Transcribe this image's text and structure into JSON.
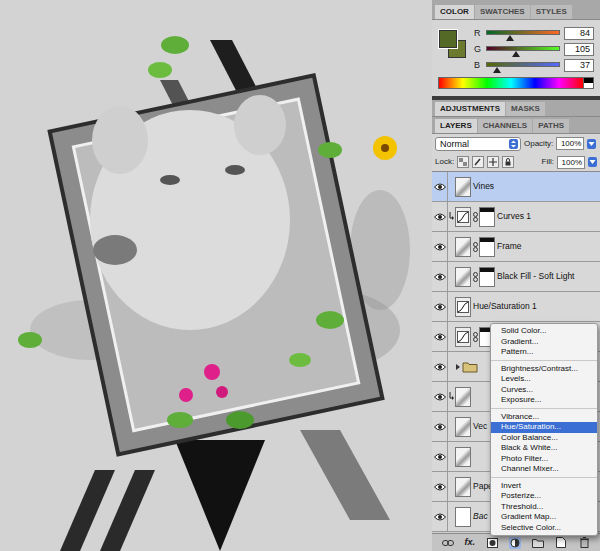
{
  "color_panel": {
    "tabs": [
      {
        "label": "COLOR",
        "selected": true
      },
      {
        "label": "SWATCHES",
        "selected": false
      },
      {
        "label": "STYLES",
        "selected": false
      }
    ],
    "foreground": "#546925",
    "background": "#6b7a2e",
    "sliders": [
      {
        "name": "R",
        "value": "84",
        "level": 0.33
      },
      {
        "name": "G",
        "value": "105",
        "level": 0.41
      },
      {
        "name": "B",
        "value": "37",
        "level": 0.15
      }
    ]
  },
  "adjustments_panel": {
    "tabs": [
      {
        "label": "ADJUSTMENTS",
        "selected": true
      },
      {
        "label": "MASKS",
        "selected": false
      }
    ]
  },
  "layers_panel": {
    "tabs": [
      {
        "label": "LAYERS",
        "selected": true
      },
      {
        "label": "CHANNELS",
        "selected": false
      },
      {
        "label": "PATHS",
        "selected": false
      }
    ],
    "blend_mode": "Normal",
    "opacity_label": "Opacity:",
    "opacity": "100%",
    "lock_label": "Lock:",
    "fill_label": "Fill:",
    "fill": "100%",
    "layers": [
      {
        "name": "Vines",
        "kind": "pixel",
        "selected": true,
        "visible": true,
        "clipped": false,
        "mask": false
      },
      {
        "name": "Curves 1",
        "kind": "adjustment",
        "selected": false,
        "visible": true,
        "clipped": true,
        "mask": true
      },
      {
        "name": "Frame",
        "kind": "pixel",
        "selected": false,
        "visible": true,
        "clipped": false,
        "mask": true
      },
      {
        "name": "Black Fill - Soft Light",
        "kind": "pixel",
        "selected": false,
        "visible": true,
        "clipped": false,
        "mask": true
      },
      {
        "name": "Hue/Saturation 1",
        "kind": "adjustment",
        "selected": false,
        "visible": true,
        "clipped": false,
        "mask": false
      },
      {
        "kind": "adjustment",
        "selected": false,
        "visible": true,
        "clipped": false,
        "mask": true
      },
      {
        "kind": "group",
        "selected": false,
        "visible": true,
        "clipped": false,
        "mask": false
      },
      {
        "kind": "pixel",
        "selected": false,
        "visible": true,
        "clipped": true,
        "mask": false
      },
      {
        "name": "Vec",
        "kind": "pixel",
        "selected": false,
        "visible": true,
        "clipped": false,
        "mask": false
      },
      {
        "kind": "pixel",
        "selected": false,
        "visible": true,
        "clipped": false,
        "mask": false
      },
      {
        "name": "Pape",
        "kind": "pixel",
        "selected": false,
        "visible": true,
        "clipped": false,
        "mask": false
      },
      {
        "name": "Bac",
        "kind": "background",
        "selected": false,
        "visible": true,
        "clipped": false,
        "mask": false
      }
    ],
    "footer": {
      "fx": "fx."
    }
  },
  "context_menu": {
    "groups": [
      [
        {
          "label": "Solid Color...",
          "selected": false
        },
        {
          "label": "Gradient...",
          "selected": false
        },
        {
          "label": "Pattern...",
          "selected": false
        }
      ],
      [
        {
          "label": "Brightness/Contrast...",
          "selected": false
        },
        {
          "label": "Levels...",
          "selected": false
        },
        {
          "label": "Curves...",
          "selected": false
        },
        {
          "label": "Exposure...",
          "selected": false
        }
      ],
      [
        {
          "label": "Vibrance...",
          "selected": false
        },
        {
          "label": "Hue/Saturation...",
          "selected": true
        },
        {
          "label": "Color Balance...",
          "selected": false
        },
        {
          "label": "Black & White...",
          "selected": false
        },
        {
          "label": "Photo Filter...",
          "selected": false
        },
        {
          "label": "Channel Mixer...",
          "selected": false
        }
      ],
      [
        {
          "label": "Invert",
          "selected": false
        },
        {
          "label": "Posterize...",
          "selected": false
        },
        {
          "label": "Threshold...",
          "selected": false
        },
        {
          "label": "Gradient Map...",
          "selected": false
        },
        {
          "label": "Selective Color...",
          "selected": false
        }
      ]
    ]
  }
}
